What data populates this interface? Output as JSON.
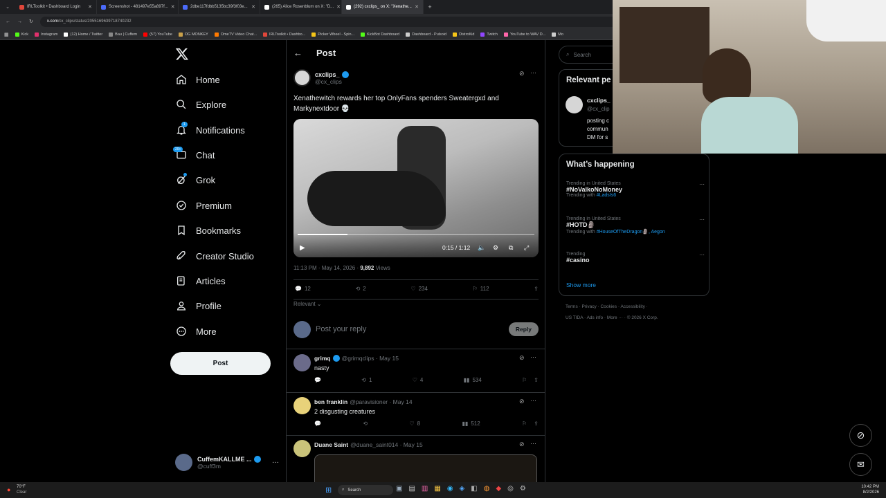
{
  "browser": {
    "tabs": [
      {
        "title": "IRLToolkit • Dashboard Login",
        "color": "#e0463a"
      },
      {
        "title": "Screenshot - 481497e55a897f...",
        "color": "#4b6bfb"
      },
      {
        "title": "2dbe117fdbb5135bc39f3f03e...",
        "color": "#4b6bfb"
      },
      {
        "title": "(265) Alice Rosenblum on X: \"D...",
        "color": "#ffffff"
      },
      {
        "title": "(292) cxclips_ on X: \"Xenathe...",
        "color": "#ffffff"
      }
    ],
    "url_domain": "x.com",
    "url_path": "/cx_clips/status/2055169639718740232",
    "bookmarks": [
      {
        "label": "Kick",
        "color": "#53fc18"
      },
      {
        "label": "Instagram",
        "color": "#e1306c"
      },
      {
        "label": "(12) Home / Twitter",
        "color": "#ffffff"
      },
      {
        "label": "Bau | Cuffem",
        "color": "#888888"
      },
      {
        "label": "(57) YouTube",
        "color": "#ff0000"
      },
      {
        "label": "OG MONKEY",
        "color": "#c9a04a"
      },
      {
        "label": "OmeTV Video Chat...",
        "color": "#ff7a00"
      },
      {
        "label": "IRLToolkit • Dashbo...",
        "color": "#e0463a"
      },
      {
        "label": "Picker Wheel - Spin...",
        "color": "#f5c518"
      },
      {
        "label": "KickBot Dashboard",
        "color": "#53fc18"
      },
      {
        "label": "Dashboard - Pulsoid",
        "color": "#cccccc"
      },
      {
        "label": "DistroKid",
        "color": "#f5c518"
      },
      {
        "label": "Twitch",
        "color": "#9146ff"
      },
      {
        "label": "YouTube to WAV D...",
        "color": "#ff66aa"
      },
      {
        "label": "Mo",
        "color": "#cccccc"
      }
    ]
  },
  "nav": {
    "items": [
      {
        "label": "Home",
        "icon": "home-icon"
      },
      {
        "label": "Explore",
        "icon": "search-icon"
      },
      {
        "label": "Notifications",
        "icon": "bell-icon"
      },
      {
        "label": "Chat",
        "icon": "chat-icon"
      },
      {
        "label": "Grok",
        "icon": "grok-icon"
      },
      {
        "label": "Premium",
        "icon": "premium-icon"
      },
      {
        "label": "Bookmarks",
        "icon": "bookmark-icon"
      },
      {
        "label": "Creator Studio",
        "icon": "rocket-icon"
      },
      {
        "label": "Articles",
        "icon": "articles-icon"
      },
      {
        "label": "Profile",
        "icon": "profile-icon"
      },
      {
        "label": "More",
        "icon": "more-circle-icon"
      }
    ],
    "notif_badge": "1",
    "chat_badge": "20+",
    "post_button": "Post",
    "account_name": "CuffemKALLME ...",
    "account_handle": "@cuff3m"
  },
  "post": {
    "header": "Post",
    "author_name": "cxclips_",
    "author_handle": "@cx_clips",
    "text": "Xenathewitch rewards her top OnlyFans spenders Sweatergxd and Markynextdoor 💀",
    "video_time": "0:15 / 1:12",
    "video_progress": 0.21,
    "timestamp": "11:13 PM · May 14, 2026 · ",
    "views_count": "9,892",
    "views_label": " Views",
    "replies": "12",
    "reposts": "2",
    "likes": "234",
    "bookmarks": "112",
    "sort": "Relevant",
    "reply_placeholder": "Post your reply",
    "reply_button": "Reply"
  },
  "replies": [
    {
      "name": "grimq",
      "handle": "@grimqclips · May 15",
      "text": "nasty",
      "replies": "",
      "reposts": "1",
      "likes": "4",
      "views": "534",
      "avatar_color": "#6b6b8a"
    },
    {
      "name": "ben franklin",
      "handle": "@paravisioner · May 14",
      "text": "2 disgusting creatures",
      "replies": "",
      "reposts": "",
      "likes": "8",
      "views": "512",
      "avatar_color": "#e8d27a"
    },
    {
      "name": "Duane Saint",
      "handle": "@duane_saint014 · May 15",
      "text": "",
      "avatar_color": "#c9c37a"
    }
  ],
  "right": {
    "search_placeholder": "Search",
    "relevant_title": "Relevant pe",
    "relevant_name": "cxclips_",
    "relevant_handle": "@cx_clip",
    "relevant_bio_1": "posting c",
    "relevant_bio_2": "commun",
    "relevant_bio_3": "DM for s",
    "happening_title": "What’s happening",
    "trends": [
      {
        "meta": "Trending in United States",
        "name": "#NoValkoNoMoney",
        "with_label": "Trending with ",
        "with_links": "#LadsIs6"
      },
      {
        "meta": "Trending in United States",
        "name": "#HOTD🗿",
        "with_label": "Trending with ",
        "with_links": "#HouseOfTheDragon🗿, Aegon"
      },
      {
        "meta": "Trending",
        "name": "#casino",
        "with_label": "",
        "with_links": ""
      }
    ],
    "show_more": "Show more",
    "footer_1": "Terms  ·  Privacy  ·  Cookies  ·  Accessibility  ·",
    "footer_2": "US TIDA  ·  Ads info  ·  More ···  ·  © 2026 X Corp."
  },
  "taskbar": {
    "weather_temp": "70°F",
    "weather_desc": "Clear",
    "search": "Search",
    "time": "10:42 PM",
    "date": "8/2/2026"
  },
  "colors": {
    "accent": "#1d9bf0",
    "background": "#000000",
    "border": "#2f3336"
  }
}
